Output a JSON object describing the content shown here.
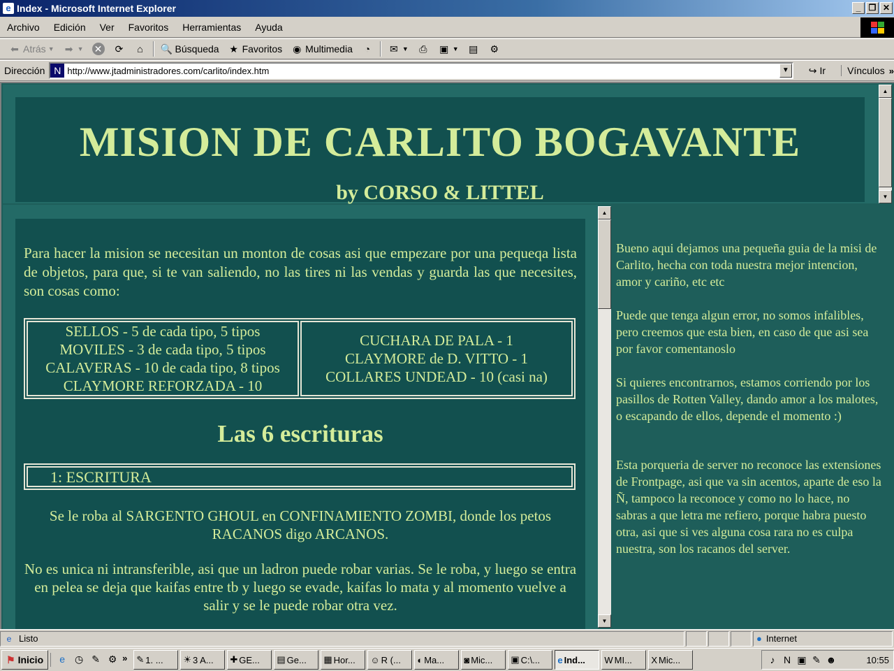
{
  "window": {
    "title": "Index - Microsoft Internet Explorer"
  },
  "menu": [
    "Archivo",
    "Edición",
    "Ver",
    "Favoritos",
    "Herramientas",
    "Ayuda"
  ],
  "toolbar": {
    "back": "Atrás",
    "search": "Búsqueda",
    "favorites": "Favoritos",
    "media": "Multimedia"
  },
  "address": {
    "label": "Dirección",
    "url": "http://www.jtadministradores.com/carlito/index.htm",
    "go": "Ir",
    "links": "Vínculos"
  },
  "page": {
    "title": "MISION DE CARLITO BOGAVANTE",
    "subtitle": "by CORSO & LITTEL",
    "intro": "Para hacer la mision se necesitan un monton de cosas asi que empezare por una pequeqa lista de objetos, para que, si te van saliendo, no las tires ni las vendas y guarda las que necesites, son cosas como:",
    "items_left": [
      "SELLOS - 5 de cada tipo, 5 tipos",
      "MOVILES - 3 de cada tipo, 5 tipos",
      "CALAVERAS - 10 de cada tipo, 8 tipos",
      "CLAYMORE REFORZADA - 10"
    ],
    "items_right": [
      "CUCHARA DE PALA - 1",
      "CLAYMORE de D. VITTO - 1",
      "COLLARES UNDEAD - 10 (casi na)"
    ],
    "section_title": "Las 6 escrituras",
    "escritura_label": "1:  ESCRITURA",
    "para1": "Se le roba al SARGENTO GHOUL en CONFINAMIENTO ZOMBI, donde los petos RACANOS digo ARCANOS.",
    "para2": "No es unica ni intransferible, asi que un ladron puede robar varias. Se le roba, y luego se entra en pelea se deja que kaifas entre tb y luego se evade, kaifas lo mata y al momento vuelve a salir y se le puede robar otra vez."
  },
  "sidebar": {
    "p1": "Bueno aqui dejamos una pequeña guia de la misi de Carlito, hecha con toda nuestra mejor intencion, amor y cariño, etc etc",
    "p2": "Puede que tenga algun error, no somos infalibles, pero creemos que esta bien, en caso de que asi sea por favor comentanoslo",
    "p3": "Si quieres encontrarnos, estamos corriendo por los pasillos de Rotten Valley, dando amor a los malotes, o escapando de ellos, depende el momento :)",
    "p4": "Esta porqueria de server no reconoce las extensiones de Frontpage, asi que va sin acentos, aparte de eso la Ñ, tampoco la reconoce y como no lo hace, no sabras a que letra me refiero, porque habra puesto otra, asi que si ves alguna cosa rara no es culpa nuestra, son los racanos del server."
  },
  "status": {
    "text": "Listo",
    "zone": "Internet"
  },
  "taskbar": {
    "start": "Inicio",
    "tasks": [
      "1. ...",
      "3 A...",
      "GE...",
      "Ge...",
      "Hor...",
      "R (...",
      "Ma...",
      "Mic...",
      "C:\\...",
      "Ind...",
      "MI...",
      "Mic..."
    ],
    "clock": "10:55"
  }
}
